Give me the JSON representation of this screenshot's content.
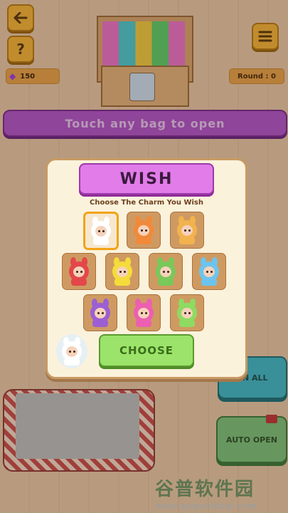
{
  "hud": {
    "back_icon": "back-arrow-icon",
    "help_label": "?",
    "menu_icon": "hamburger-menu-icon",
    "gems_value": "150",
    "round_label": "Round : 0"
  },
  "banner": {
    "text": "Touch any bag to open"
  },
  "modal": {
    "title": "WISH",
    "subtitle": "Choose The Charm You Wish",
    "choose_label": "CHOOSE",
    "selected_index": 0,
    "charms": [
      {
        "name": "white-cat-charm",
        "color": "#ffffff"
      },
      {
        "name": "orange-fox-charm",
        "color": "#f08a3a"
      },
      {
        "name": "tan-bunny-charm",
        "color": "#f2b24e"
      },
      {
        "name": "red-bunny-charm",
        "color": "#e4474a"
      },
      {
        "name": "yellow-bunny-charm",
        "color": "#f5dc3a"
      },
      {
        "name": "green-bunny-charm",
        "color": "#79c85a"
      },
      {
        "name": "blue-bunny-charm",
        "color": "#6cc4ee"
      },
      {
        "name": "purple-bunny-charm",
        "color": "#9b5fd3"
      },
      {
        "name": "pink-bunny-charm",
        "color": "#ec5fb1"
      },
      {
        "name": "lime-bunny-charm",
        "color": "#8edb62"
      }
    ]
  },
  "background": {
    "open_all_label": "EN ALL",
    "auto_open_label": "AUTO OPEN"
  },
  "watermark": {
    "line1": "谷普软件园",
    "line2": "www.gupuxiazai.com"
  },
  "colors": {
    "accent_purple": "#b254c8",
    "accent_green": "#9be36a",
    "panel": "#fbf2dc"
  }
}
